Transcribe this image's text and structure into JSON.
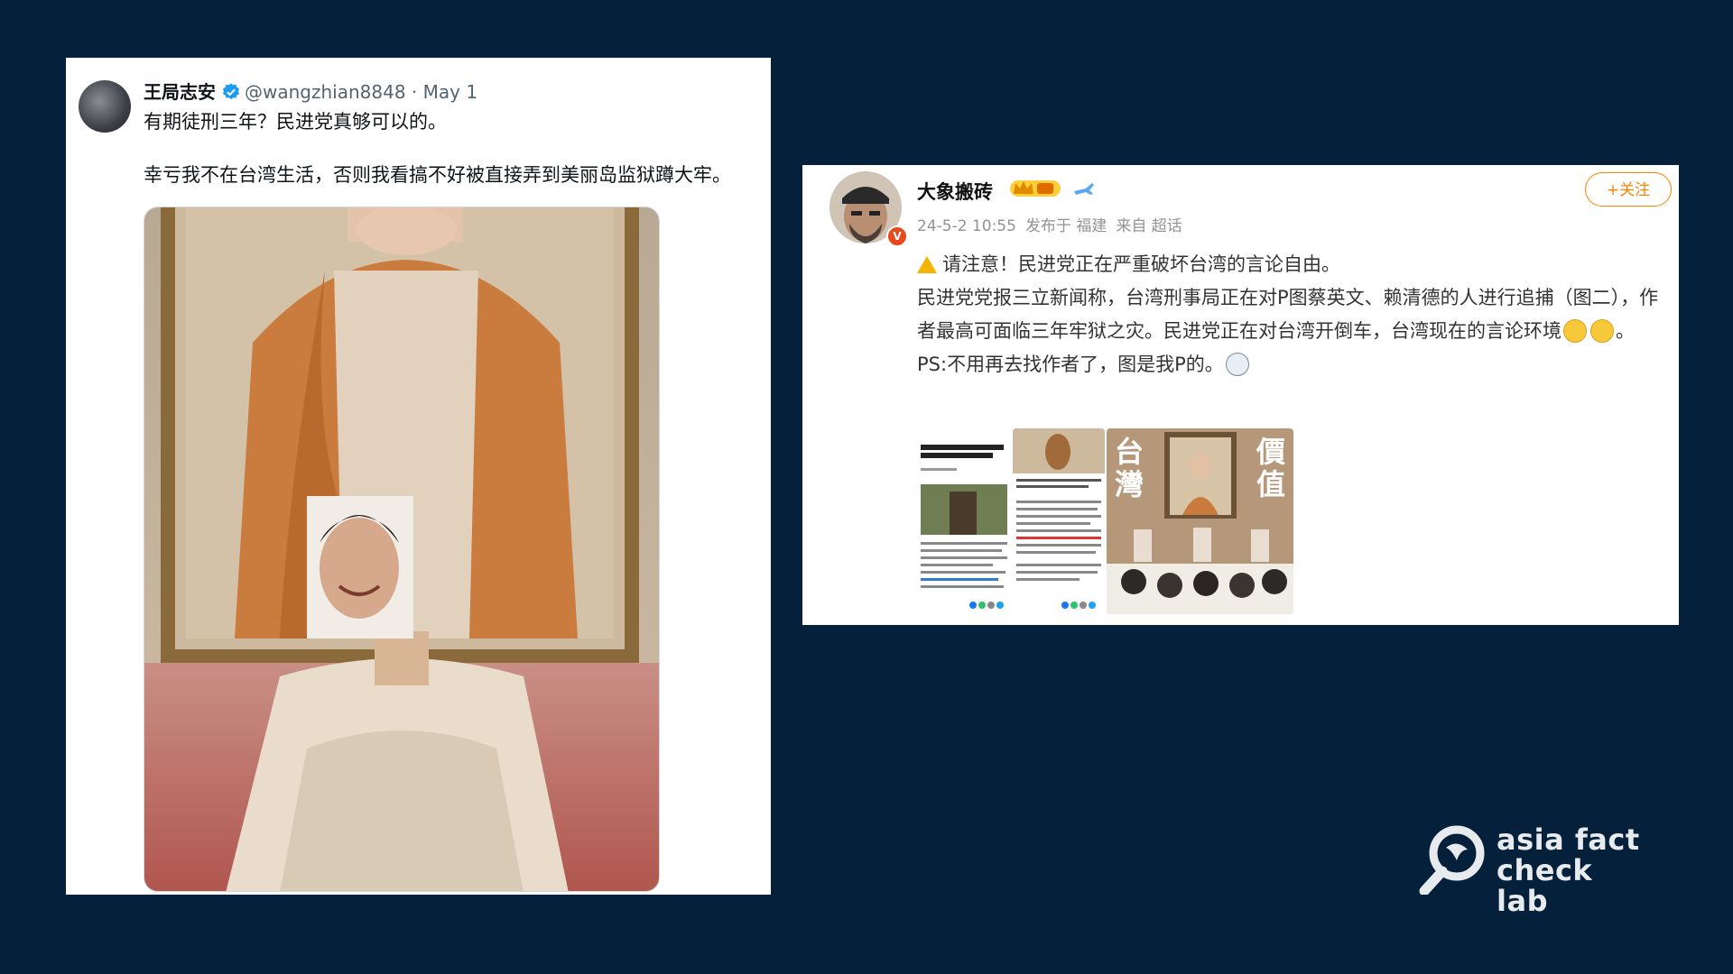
{
  "tweet": {
    "author_name": "王局志安",
    "handle": "@wangzhian8848",
    "separator": "·",
    "date": "May 1",
    "line1": "有期徒刑三年？民进党真够可以的。",
    "line2": "幸亏我不在台湾生活，否则我看搞不好被直接弄到美丽岛监狱蹲大牢。",
    "verified_icon": "verified-badge-icon",
    "colors": {
      "verified": "#1d9bf0"
    }
  },
  "weibo": {
    "author_name": "大象搬砖",
    "follow_label": "+关注",
    "meta": {
      "time": "24-5-2 10:55",
      "from": "发布于 福建",
      "source": "来自 超话"
    },
    "para1": "请注意！民进党正在严重破坏台湾的言论自由。",
    "para2a": "民进党党报三立新闻称，台湾刑事局正在对P图蔡英文、赖清德的人进行追捕（图二），作者最高可面临三年牢狱之灾。民进党正在对台湾开倒车，台湾现在的言论环境",
    "para2b": "。",
    "para3a": "PS:不用再去找作者了，图是我P的。",
    "thumb3_left": "台灣",
    "thumb3_right": "價值",
    "colors": {
      "follow": "#ff8200",
      "meta": "#939393",
      "vbadge": "#e8491d"
    }
  },
  "logo": {
    "line1": "asia fact",
    "line2": "check lab"
  }
}
